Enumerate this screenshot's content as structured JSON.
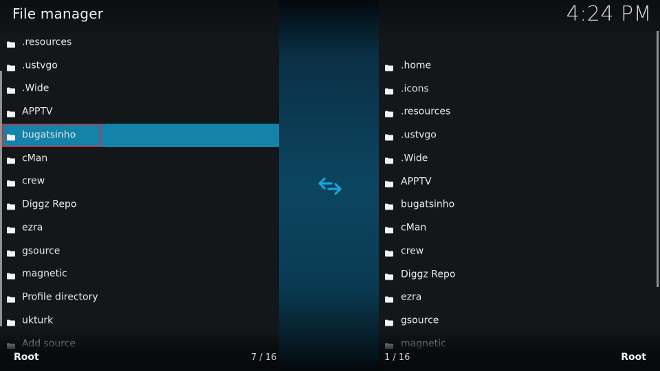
{
  "header": {
    "title": "File manager",
    "clock": "4:24 PM"
  },
  "left_panel": {
    "items": [
      {
        "label": ".resources",
        "icon": "folder-icon"
      },
      {
        "label": ".ustvgo",
        "icon": "folder-icon"
      },
      {
        "label": ".Wide",
        "icon": "folder-icon"
      },
      {
        "label": "APPTV",
        "icon": "folder-icon"
      },
      {
        "label": "bugatsinho",
        "icon": "folder-icon",
        "selected": true
      },
      {
        "label": "cMan",
        "icon": "folder-icon"
      },
      {
        "label": "crew",
        "icon": "folder-icon"
      },
      {
        "label": "Diggz Repo",
        "icon": "folder-icon"
      },
      {
        "label": "ezra",
        "icon": "folder-icon"
      },
      {
        "label": "gsource",
        "icon": "folder-icon"
      },
      {
        "label": "magnetic",
        "icon": "folder-icon"
      },
      {
        "label": "Profile directory",
        "icon": "folder-icon"
      },
      {
        "label": "ukturk",
        "icon": "folder-icon"
      },
      {
        "label": "Add source",
        "icon": "folder-icon"
      }
    ],
    "footer_label": "Root",
    "position": "7 / 16"
  },
  "center": {
    "swap_icon": "swap-arrows-icon"
  },
  "right_panel": {
    "items": [
      {
        "label": ".home",
        "icon": "folder-icon"
      },
      {
        "label": ".icons",
        "icon": "folder-icon"
      },
      {
        "label": ".resources",
        "icon": "folder-icon"
      },
      {
        "label": ".ustvgo",
        "icon": "folder-icon"
      },
      {
        "label": ".Wide",
        "icon": "folder-icon"
      },
      {
        "label": "APPTV",
        "icon": "folder-icon"
      },
      {
        "label": "bugatsinho",
        "icon": "folder-icon"
      },
      {
        "label": "cMan",
        "icon": "folder-icon"
      },
      {
        "label": "crew",
        "icon": "folder-icon"
      },
      {
        "label": "Diggz Repo",
        "icon": "folder-icon"
      },
      {
        "label": "ezra",
        "icon": "folder-icon"
      },
      {
        "label": "gsource",
        "icon": "folder-icon"
      },
      {
        "label": "magnetic",
        "icon": "folder-icon"
      }
    ],
    "footer_label": "Root",
    "position": "1 / 16"
  },
  "colors": {
    "selection": "#1383a9",
    "focus_border": "#b83a4a",
    "accent_icon": "#1aa3d8"
  }
}
